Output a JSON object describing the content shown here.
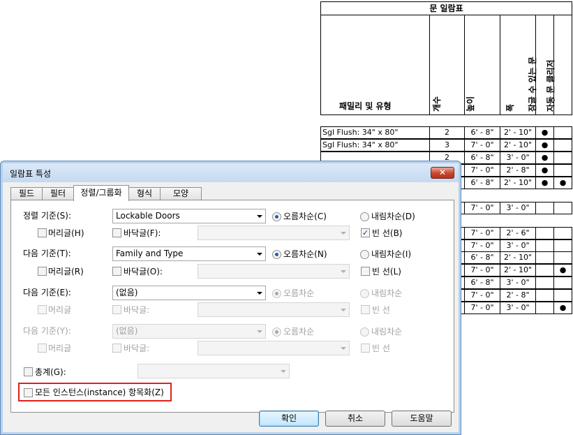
{
  "schedule": {
    "title": "문 일람표",
    "headers": {
      "type": "패밀리 및 유형",
      "count": "개수",
      "height": "높이",
      "width": "폭",
      "lockable": "잠글 수 있는 문",
      "auto_closer": "자동 문 클리저"
    },
    "rows": [
      {
        "type": "Sgl Flush: 34\" x 80\"",
        "count": "2",
        "height": "6' - 8\"",
        "width": "2' - 10\"",
        "lock": "●",
        "auto": ""
      },
      {
        "type": "Sgl Flush: 34\" x 80\"",
        "count": "3",
        "height": "7' - 0\"",
        "width": "2' - 10\"",
        "lock": "●",
        "auto": ""
      },
      {
        "type": "",
        "count": "2",
        "height": "6' - 8\"",
        "width": "3' - 0\"",
        "lock": "●",
        "auto": ""
      },
      {
        "type": "",
        "count": "",
        "height": "7' - 0\"",
        "width": "2' - 8\"",
        "lock": "●",
        "auto": ""
      },
      {
        "type": "",
        "count": "",
        "height": "6' - 8\"",
        "width": "2' - 10\"",
        "lock": "●",
        "auto": "●"
      },
      {
        "type": "",
        "count": "",
        "height": "7' - 0\"",
        "width": "3' - 0\"",
        "lock": "",
        "auto": ""
      },
      {
        "type": "",
        "count": "",
        "height": "7' - 0\"",
        "width": "2' - 6\"",
        "lock": "",
        "auto": ""
      },
      {
        "type": "",
        "count": "",
        "height": "7' - 0\"",
        "width": "3' - 0\"",
        "lock": "",
        "auto": ""
      },
      {
        "type": "",
        "count": "",
        "height": "6' - 8\"",
        "width": "2' - 10\"",
        "lock": "",
        "auto": ""
      },
      {
        "type": "",
        "count": "",
        "height": "7' - 0\"",
        "width": "2' - 10\"",
        "lock": "",
        "auto": "●"
      },
      {
        "type": "",
        "count": "",
        "height": "6' - 8\"",
        "width": "3' - 0\"",
        "lock": "",
        "auto": ""
      },
      {
        "type": "",
        "count": "",
        "height": "7' - 0\"",
        "width": "2' - 8\"",
        "lock": "",
        "auto": ""
      },
      {
        "type": "",
        "count": "",
        "height": "7' - 0\"",
        "width": "3' - 0\"",
        "lock": "",
        "auto": "●"
      }
    ]
  },
  "dialog": {
    "title": "일람표 특성",
    "close_glyph": "✕",
    "tabs": [
      "필드",
      "필터",
      "정렬/그룹화",
      "형식",
      "모양"
    ],
    "sort1": {
      "label": "정렬 기준(S):",
      "field": "Lockable Doors",
      "asc": "오름차순(C)",
      "desc": "내림차순(D)",
      "header": "머리글(H)",
      "footer": "바닥글(F):",
      "blank": "빈 선(B)"
    },
    "sort2": {
      "label": "다음 기준(T):",
      "field": "Family and Type",
      "asc": "오름차순(N)",
      "desc": "내림차순(I)",
      "header": "머리글(R)",
      "footer": "바닥글(O):",
      "blank": "빈 선(L)"
    },
    "sort3": {
      "label": "다음 기준(E):",
      "field": "(없음)",
      "asc": "오름차순",
      "desc": "내림차순",
      "header": "머리글",
      "footer": "바닥글:",
      "blank": "빈 선"
    },
    "sort4": {
      "label": "다음 기준(Y):",
      "field": "(없음)",
      "asc": "오름차순",
      "desc": "내림차순",
      "header": "머리글",
      "footer": "바닥글:",
      "blank": "빈 선"
    },
    "total_label": "총계(G):",
    "itemize_label": "모든 인스턴스(instance) 항목화(Z)",
    "check_glyph": "✓",
    "ok": "확인",
    "cancel": "취소",
    "help": "도움말"
  }
}
